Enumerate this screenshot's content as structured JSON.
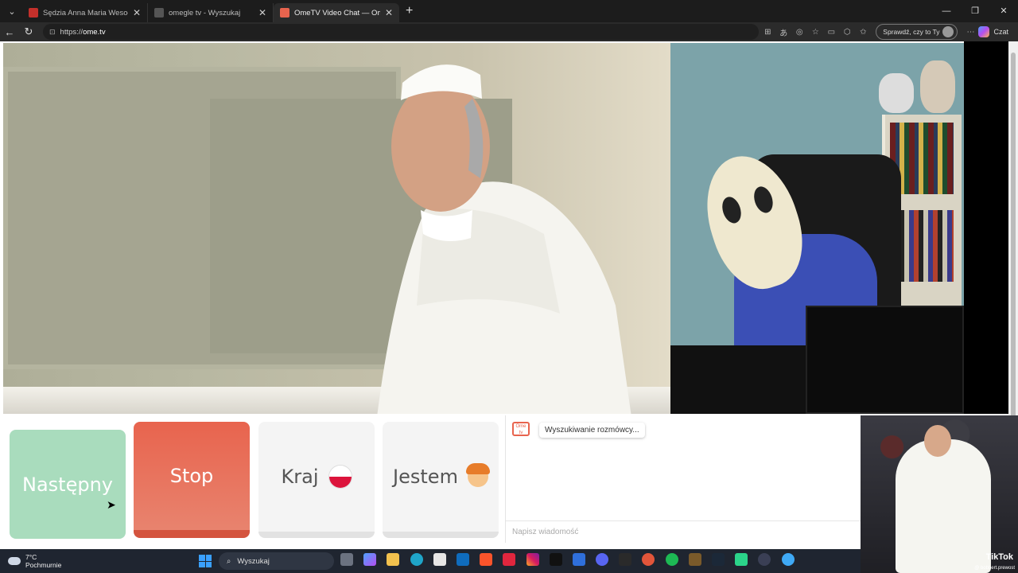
{
  "browser": {
    "tabs": [
      {
        "title": "Sędzia Anna Maria Wesołowska o",
        "favicon_color": "#c4302b",
        "active": false
      },
      {
        "title": "omegle tv - Wyszukaj",
        "favicon_color": "#555555",
        "active": false
      },
      {
        "title": "OmeTV Video Chat — Omegle",
        "favicon_color": "#e8644e",
        "active": true
      }
    ],
    "new_tab_label": "+",
    "url_prefix": "https://",
    "url_domain": "ome.tv",
    "profile_label": "Sprawdź, czy to Ty",
    "copilot_label": "Czat"
  },
  "controls": {
    "next_label": "Następny",
    "stop_label": "Stop",
    "country_label": "Kraj",
    "gender_label": "Jestem"
  },
  "chat": {
    "logo_text": "Ome tv",
    "status": "Wyszukiwanie rozmówcy...",
    "input_placeholder": "Napisz wiadomość"
  },
  "overlay": {
    "tiktok_label": "TikTok",
    "tiktok_user": "@ bobbert.prewost"
  },
  "taskbar": {
    "weather_temp": "7°C",
    "weather_desc": "Pochmurnie",
    "search_placeholder": "Wyszukaj",
    "icons": [
      "file-explorer-icon",
      "copilot-icon",
      "folder-icon",
      "edge-icon",
      "store-icon",
      "outlook-icon",
      "brave-icon",
      "wps-icon",
      "instagram-icon",
      "tiktok-icon",
      "calendar-icon",
      "discord-icon",
      "ubisoft-icon",
      "app-icon",
      "spotify-icon",
      "app2-icon",
      "steam-icon",
      "app3-icon",
      "app4-icon",
      "app5-icon"
    ]
  },
  "colors": {
    "next": "#a9dcbd",
    "stop": "#e8644e",
    "neutral": "#f4f4f4"
  }
}
